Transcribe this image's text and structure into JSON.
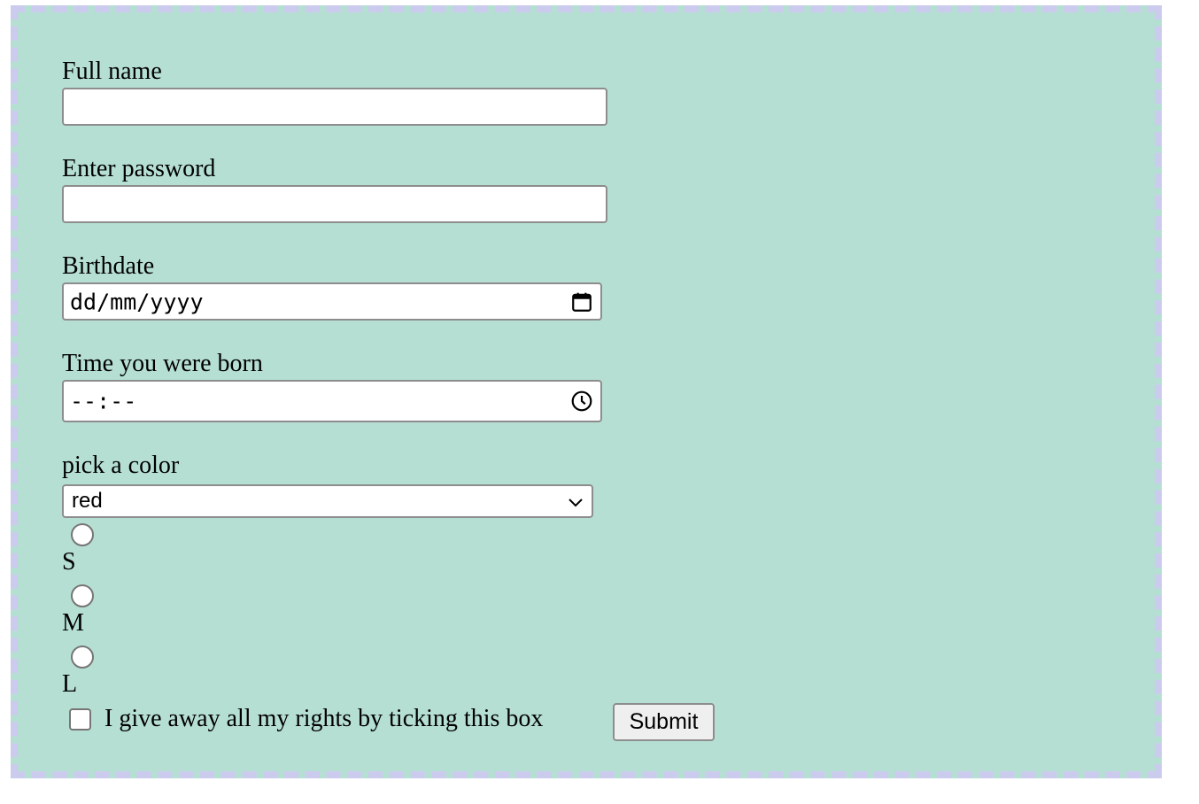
{
  "form": {
    "full_name": {
      "label": "Full name",
      "value": "",
      "placeholder": ""
    },
    "password": {
      "label": "Enter password",
      "value": "",
      "placeholder": ""
    },
    "birthdate": {
      "label": "Birthdate",
      "placeholder": "dd/mm/yyyy",
      "icon": "calendar-icon"
    },
    "birth_time": {
      "label": "Time you were born",
      "placeholder": "--:--",
      "icon": "clock-icon"
    },
    "color": {
      "label": "pick a color",
      "selected": "red",
      "icon": "chevron-down-icon"
    },
    "sizes": [
      {
        "label": "S",
        "checked": false
      },
      {
        "label": "M",
        "checked": false
      },
      {
        "label": "L",
        "checked": false
      }
    ],
    "consent": {
      "label": "I give away all my rights by ticking this box",
      "checked": false
    },
    "submit_label": "Submit"
  },
  "colors": {
    "background": "#b6dfd4",
    "border": "#cbcbee"
  }
}
